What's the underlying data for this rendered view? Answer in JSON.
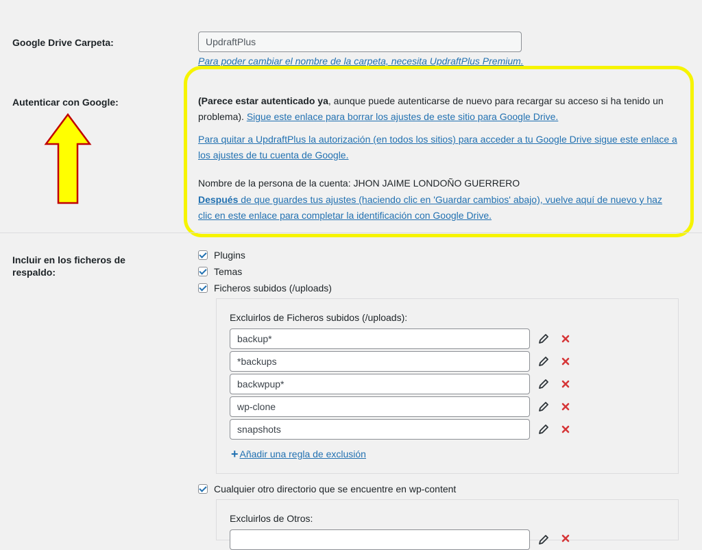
{
  "settings": {
    "folder": {
      "label": "Google Drive Carpeta:",
      "value": "UpdraftPlus",
      "premium_note": "Para poder cambiar el nombre de la carpeta, necesita UpdraftPlus Premium."
    },
    "auth": {
      "label": "Autenticar con Google:",
      "status_bold": "(Parece estar autenticado ya",
      "status_rest": ", aunque puede autenticarse de nuevo para recargar su acceso si ha tenido un problema). ",
      "reset_link": "Sigue este enlace para borrar los ajustes de este sitio para Google Drive.",
      "revoke_link": "Para quitar a UpdraftPlus la autorización (en todos los sitios) para acceder a tu Google Drive sigue este enlace a los ajustes de tu cuenta de Google.",
      "account_owner": "Nombre de la persona de la cuenta: JHON JAIME LONDOÑO GUERRERO",
      "after_bold": "Después",
      "after_rest": " de que guardes tus ajustes (haciendo clic en 'Guardar cambios' abajo), vuelve aquí de nuevo y haz clic en este enlace para completar la identificación con Google Drive."
    },
    "include": {
      "label": "Incluir en los ficheros de respaldo:",
      "options": [
        {
          "label": "Plugins",
          "checked": true
        },
        {
          "label": "Temas",
          "checked": true
        },
        {
          "label": "Ficheros subidos (/uploads)",
          "checked": true
        }
      ],
      "uploads_exclude": {
        "title": "Excluirlos de Ficheros subidos (/uploads):",
        "rules": [
          "backup*",
          "*backups",
          "backwpup*",
          "wp-clone",
          "snapshots"
        ],
        "add_rule": "Añadir una regla de exclusión"
      },
      "other": {
        "label": "Cualquier otro directorio que se encuentre en wp-content",
        "checked": true
      },
      "other_exclude": {
        "title": "Excluirlos de Otros:"
      }
    }
  },
  "colors": {
    "link": "#2271b1",
    "highlight": "#f6f400",
    "arrow_fill": "#ffff00",
    "arrow_stroke": "#c00000",
    "delete": "#d63638"
  }
}
